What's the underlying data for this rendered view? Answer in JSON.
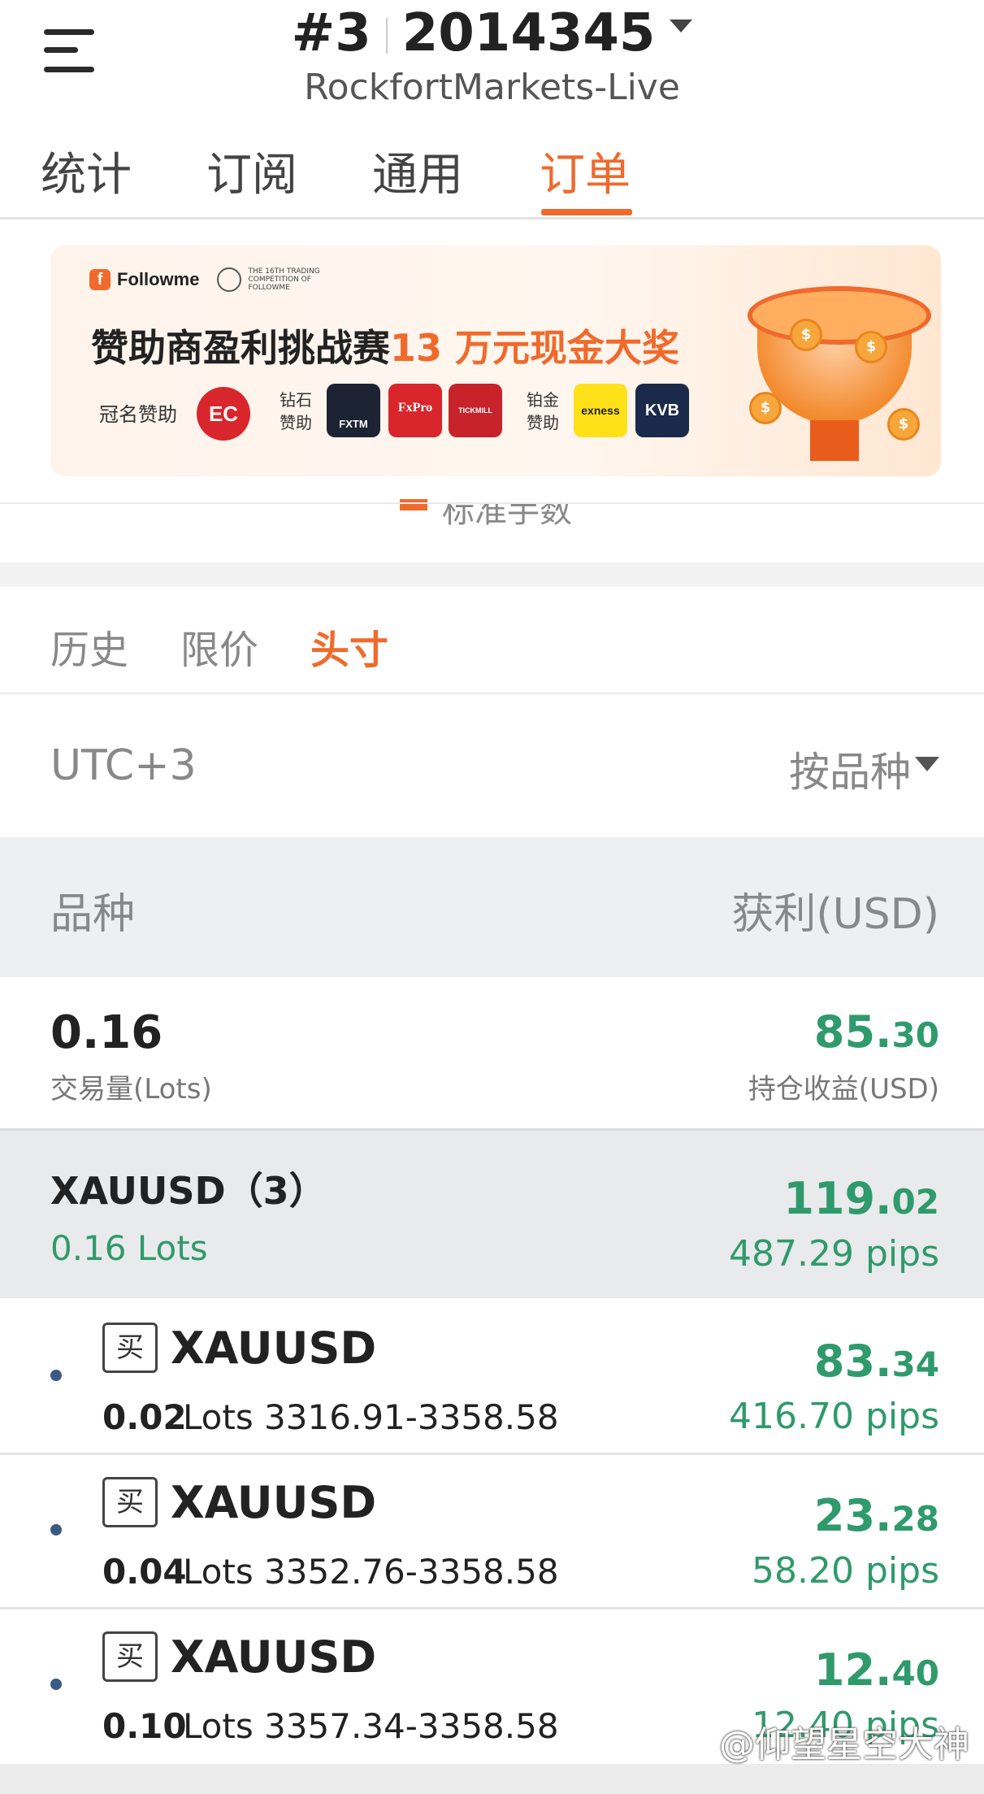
{
  "header": {
    "account_index": "#3",
    "account_number": "2014345",
    "server": "RockfortMarkets-Live"
  },
  "tabs": [
    "统计",
    "订阅",
    "通用",
    "订单"
  ],
  "active_tab": "订单",
  "banner": {
    "brand": "Followme",
    "competition_small": "THE 16TH TRADING COMPETITION OF FOLLOWME",
    "title_main": "赞助商盈利挑战赛",
    "title_highlight": "13 万元现金大奖",
    "title_sponsor": "冠名赞助",
    "title_sponsor_logo": "EC",
    "diamond_label_1": "钻石",
    "diamond_label_2": "赞助",
    "diamond_sponsors": [
      "FXTM",
      "FxPro",
      "TICKMILL"
    ],
    "platinum_label_1": "铂金",
    "platinum_label_2": "赞助",
    "platinum_sponsors": [
      "exness",
      "KVB"
    ]
  },
  "legend_partial": "标准手数",
  "sub_tabs": [
    "历史",
    "限价",
    "头寸"
  ],
  "active_sub_tab": "头寸",
  "timezone": "UTC+3",
  "group_by": "按品种",
  "table_header": {
    "symbol": "品种",
    "profit": "获利(USD)"
  },
  "summary": {
    "lots": "0.16",
    "lots_label": "交易量(Lots)",
    "profit_int": "85.",
    "profit_dec": "30",
    "profit_label": "持仓收益(USD)"
  },
  "group": {
    "symbol": "XAUUSD（3）",
    "lots": "0.16 Lots",
    "profit_int": "119.",
    "profit_dec": "02",
    "pips": "487.29 pips"
  },
  "positions": [
    {
      "side": "买",
      "symbol": "XAUUSD",
      "lots": "0.02",
      "range": "Lots 3316.91-3358.58",
      "profit_int": "83.",
      "profit_dec": "34",
      "pips": "416.70 pips"
    },
    {
      "side": "买",
      "symbol": "XAUUSD",
      "lots": "0.04",
      "range": "Lots 3352.76-3358.58",
      "profit_int": "23.",
      "profit_dec": "28",
      "pips": "58.20 pips"
    },
    {
      "side": "买",
      "symbol": "XAUUSD",
      "lots": "0.10",
      "range": "Lots 3357.34-3358.58",
      "profit_int": "12.",
      "profit_dec": "40",
      "pips": "12.40 pips"
    }
  ],
  "watermark": "@仰望星空大神",
  "colors": {
    "accent": "#f06a2c",
    "profit_green": "#2f9a6b",
    "dot_blue": "#3b5a86"
  }
}
